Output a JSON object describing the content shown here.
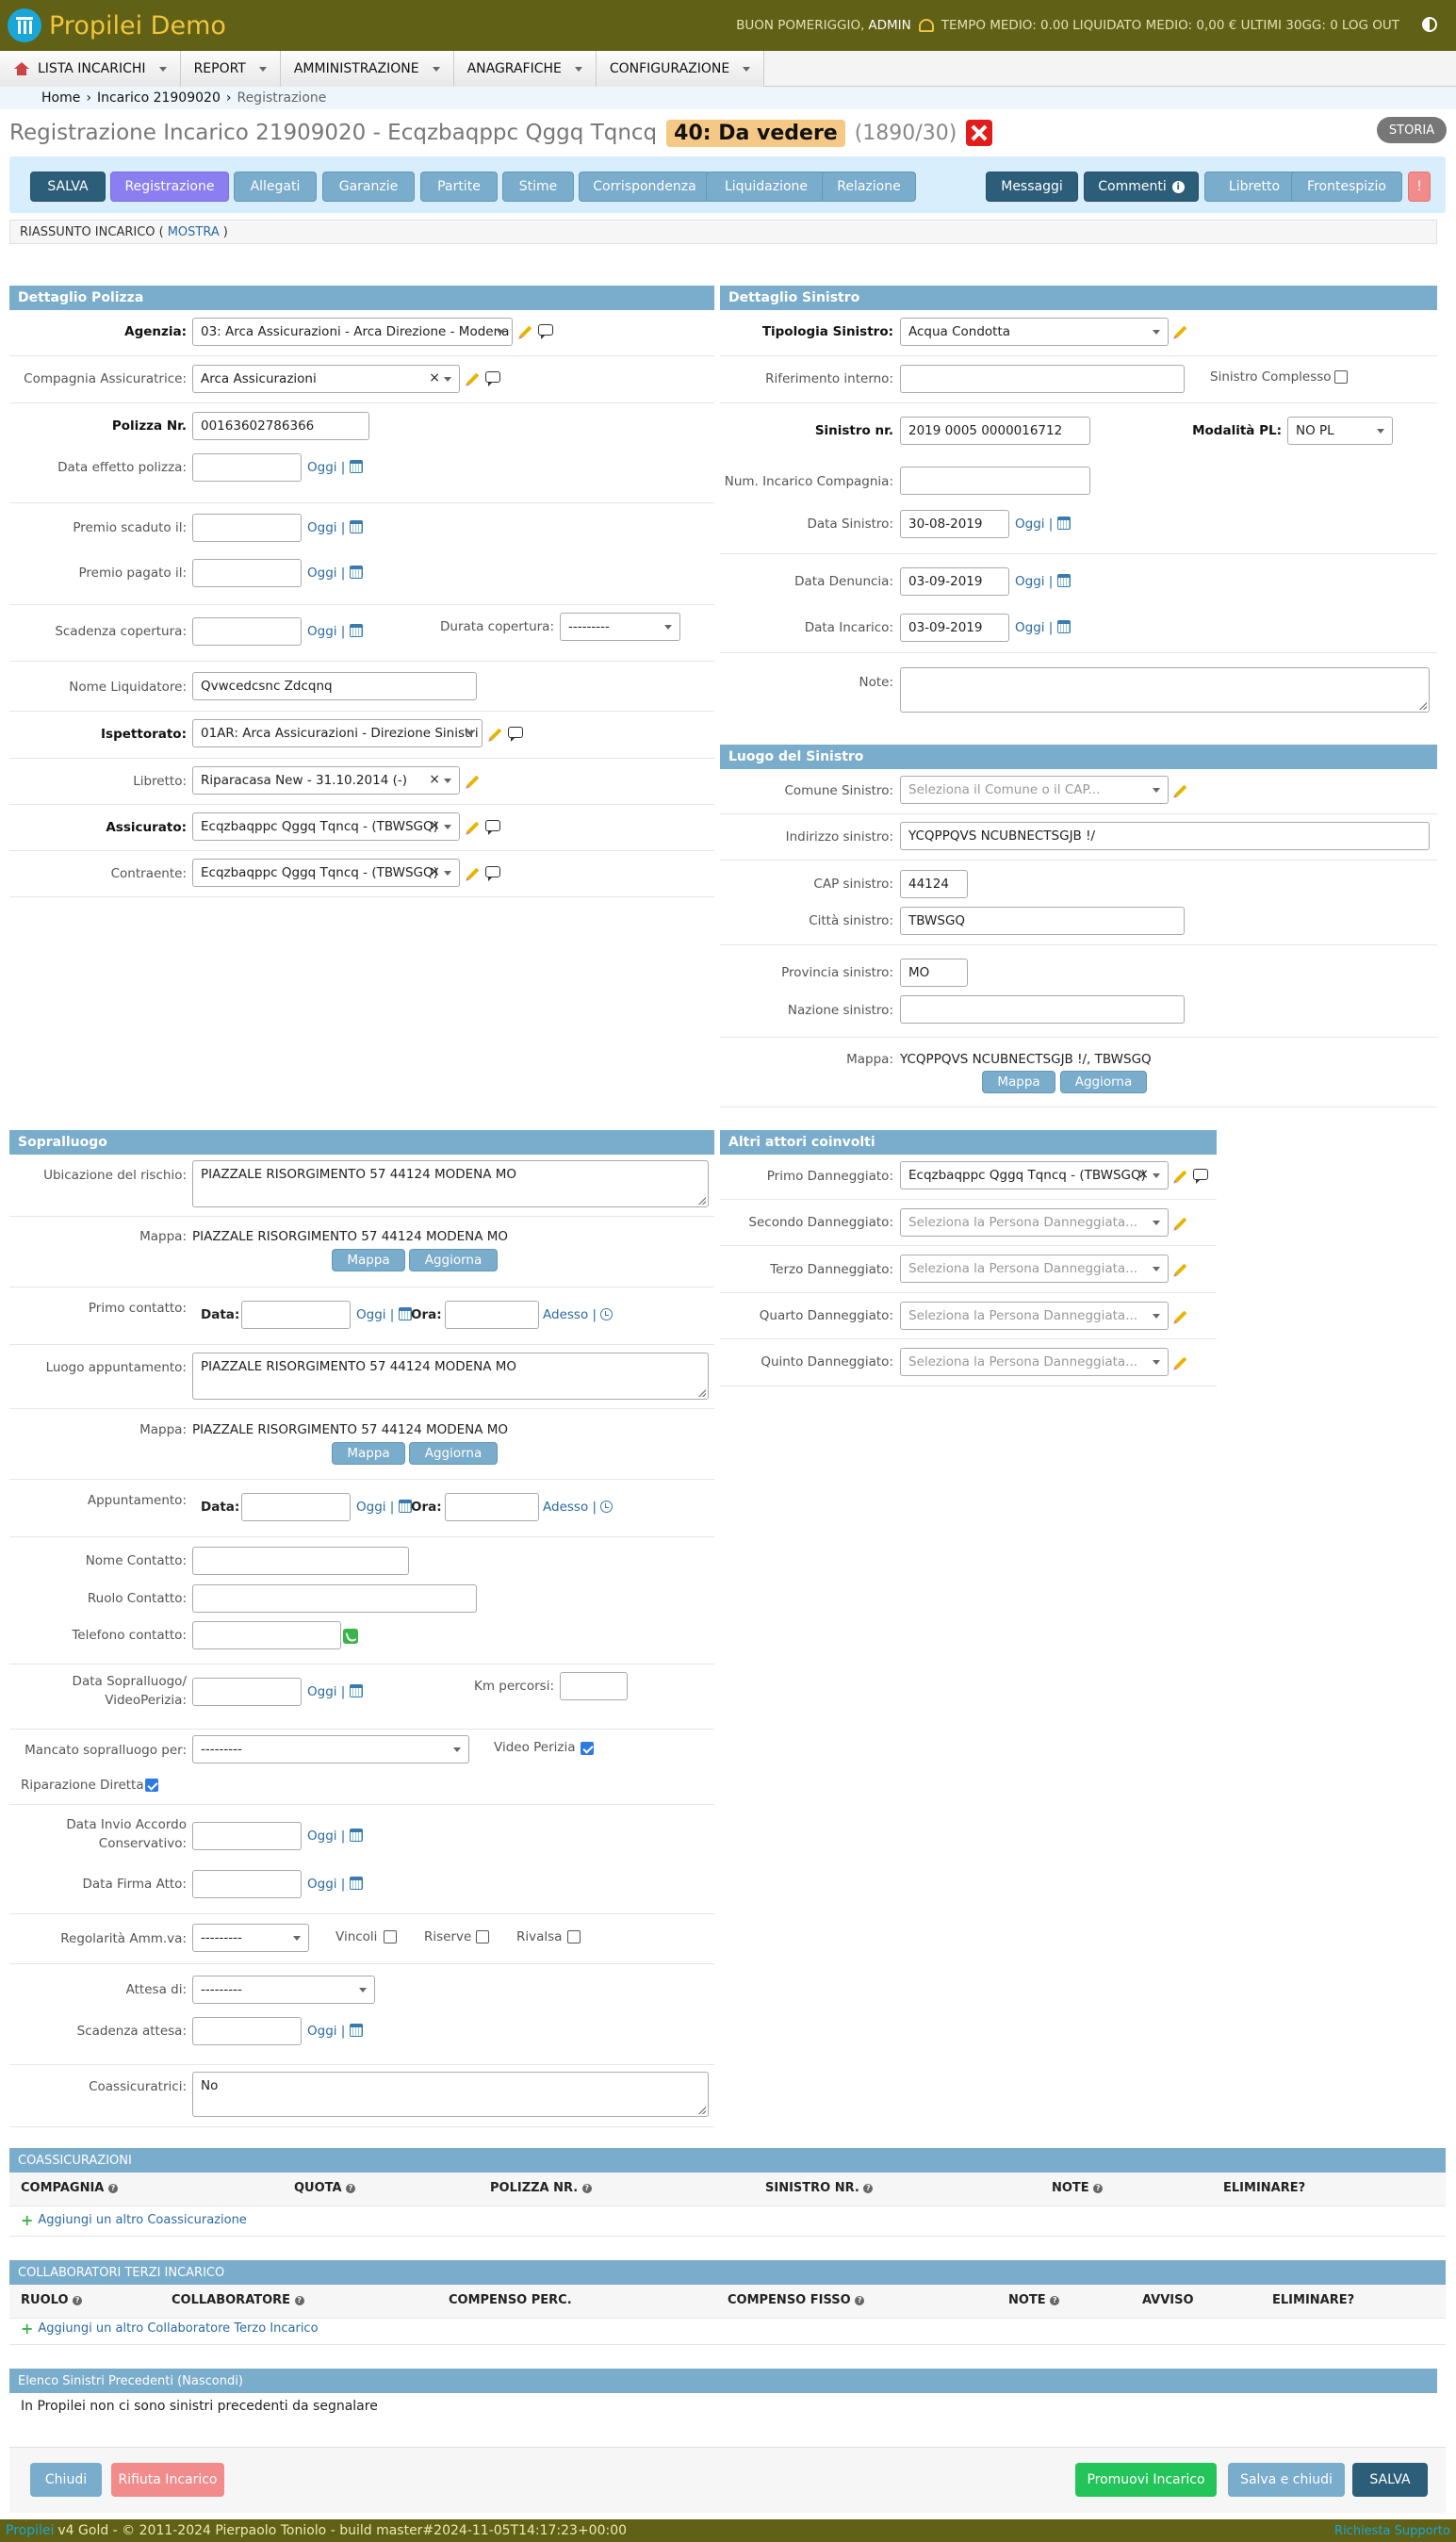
{
  "app": {
    "name": "Propilei Demo"
  },
  "topinfo": {
    "greeting": "BUON POMERIGGIO,",
    "user": "ADMIN",
    "tempo": "TEMPO MEDIO: 0.00",
    "liquidato": "LIQUIDATO MEDIO: 0,00 € ULTIMI 30GG: 0",
    "logout": "LOG OUT"
  },
  "menu": [
    "LISTA INCARICHI",
    "REPORT",
    "AMMINISTRAZIONE",
    "ANAGRAFICHE",
    "CONFIGURAZIONE"
  ],
  "breadcrumb": {
    "home": "Home",
    "sep": "›",
    "incarico": "Incarico 21909020",
    "current": "Registrazione"
  },
  "title": {
    "text": "Registrazione Incarico 21909020 - Ecqzbaqppc Qggq Tqncq",
    "status": "40: Da vedere",
    "count": "(1890/30)",
    "storia": "STORIA"
  },
  "toolbar": {
    "left": [
      "SALVA",
      "Registrazione",
      "Allegati",
      "Garanzie",
      "Partite",
      "Stime",
      "Corrispondenza",
      "Liquidazione",
      "Relazione"
    ],
    "right": [
      "Messaggi",
      "Commenti",
      "Libretto",
      "Frontespizio",
      "!"
    ]
  },
  "riassunto": {
    "label": "RIASSUNTO INCARICO (",
    "link": "MOSTRA",
    "close": ")"
  },
  "common": {
    "oggi": "Oggi |",
    "adesso": "Adesso |",
    "mappa": "Mappa",
    "aggiorna": "Aggiorna",
    "data": "Data:",
    "ora": "Ora:"
  },
  "polizza": {
    "head": "Dettaglio Polizza",
    "agenzia_lbl": "Agenzia:",
    "agenzia": "03: Arca Assicurazioni - Arca Direzione - Modena",
    "compagnia_lbl": "Compagnia Assicuratrice:",
    "compagnia": "Arca Assicurazioni",
    "polizza_lbl": "Polizza Nr.",
    "polizza": "00163602786366",
    "effetto_lbl": "Data effetto polizza:",
    "scaduto_lbl": "Premio scaduto il:",
    "pagato_lbl": "Premio pagato il:",
    "scadenza_lbl": "Scadenza copertura:",
    "durata_lbl": "Durata copertura:",
    "durata": "---------",
    "liquidatore_lbl": "Nome Liquidatore:",
    "liquidatore": "Qvwcedcsnc Zdcqnq",
    "ispettorato_lbl": "Ispettorato:",
    "ispettorato": "01AR: Arca Assicurazioni - Direzione Sinistri",
    "libretto_lbl": "Libretto:",
    "libretto": "Riparacasa New - 31.10.2014 (-)",
    "assicurato_lbl": "Assicurato:",
    "assicurato": "Ecqzbaqppc Qggq Tqncq - (TBWSGQ)",
    "contraente_lbl": "Contraente:",
    "contraente": "Ecqzbaqppc Qggq Tqncq - (TBWSGQ)"
  },
  "sinistro": {
    "head": "Dettaglio Sinistro",
    "tipologia_lbl": "Tipologia Sinistro:",
    "tipologia": "Acqua Condotta",
    "rif_lbl": "Riferimento interno:",
    "complesso_lbl": "Sinistro Complesso",
    "nr_lbl": "Sinistro nr.",
    "nr": "2019 0005 0000016712",
    "pl_lbl": "Modalità PL:",
    "pl": "NO PL",
    "num_lbl": "Num. Incarico Compagnia:",
    "data_lbl": "Data Sinistro:",
    "data": "30-08-2019",
    "denuncia_lbl": "Data Denuncia:",
    "denuncia": "03-09-2019",
    "incarico_lbl": "Data Incarico:",
    "incarico": "03-09-2019",
    "note_lbl": "Note:"
  },
  "luogo": {
    "head": "Luogo del Sinistro",
    "comune_lbl": "Comune Sinistro:",
    "comune_ph": "Seleziona il Comune o il CAP...",
    "indirizzo_lbl": "Indirizzo sinistro:",
    "indirizzo": "YCQPPQVS NCUBNECTSGJB !/",
    "cap_lbl": "CAP sinistro:",
    "cap": "44124",
    "citta_lbl": "Città sinistro:",
    "citta": "TBWSGQ",
    "provincia_lbl": "Provincia sinistro:",
    "provincia": "MO",
    "nazione_lbl": "Nazione sinistro:",
    "mappa_lbl": "Mappa:",
    "mappa": "YCQPPQVS NCUBNECTSGJB !/, TBWSGQ"
  },
  "sopralluogo": {
    "head": "Sopralluogo",
    "ubicazione_lbl": "Ubicazione del rischio:",
    "ubicazione": "PIAZZALE RISORGIMENTO 57 44124 MODENA MO",
    "mappa_lbl": "Mappa:",
    "mappa1": "PIAZZALE RISORGIMENTO 57 44124 MODENA MO",
    "primo_lbl": "Primo contatto:",
    "luogo_lbl": "Luogo appuntamento:",
    "luogo": "PIAZZALE RISORGIMENTO 57 44124 MODENA MO",
    "mappa2": "PIAZZALE RISORGIMENTO 57 44124 MODENA MO",
    "app_lbl": "Appuntamento:",
    "nome_lbl": "Nome Contatto:",
    "ruolo_lbl": "Ruolo Contatto:",
    "tel_lbl": "Telefono contatto:",
    "datasop_lbl1": "Data Sopralluogo/",
    "datasop_lbl2": "VideoPerizia:",
    "km_lbl": "Km percorsi:",
    "mancato_lbl": "Mancato sopralluogo per:",
    "mancato": "---------",
    "video_lbl": "Video Perizia",
    "riparazione_lbl": "Riparazione Diretta",
    "accordo_lbl1": "Data Invio Accordo",
    "accordo_lbl2": "Conservativo:",
    "firma_lbl": "Data Firma Atto:",
    "regolarita_lbl": "Regolarità Amm.va:",
    "regolarita": "---------",
    "vincoli_lbl": "Vincoli",
    "riserve_lbl": "Riserve",
    "rivalsa_lbl": "Rivalsa",
    "attesa_lbl": "Attesa di:",
    "attesa": "---------",
    "scadattesa_lbl": "Scadenza attesa:",
    "coass_lbl": "Coassicuratrici:",
    "coass": "No"
  },
  "attori": {
    "head": "Altri attori coinvolti",
    "primo_lbl": "Primo Danneggiato:",
    "primo": "Ecqzbaqppc Qggq Tqncq - (TBWSGQ)",
    "secondo_lbl": "Secondo Danneggiato:",
    "terzo_lbl": "Terzo Danneggiato:",
    "quarto_lbl": "Quarto Danneggiato:",
    "quinto_lbl": "Quinto Danneggiato:",
    "ph": "Seleziona la Persona Danneggiata..."
  },
  "coassicurazioni": {
    "head": "COASSICURAZIONI",
    "cols": [
      "COMPAGNIA",
      "QUOTA",
      "POLIZZA NR.",
      "SINISTRO NR.",
      "NOTE",
      "ELIMINARE?"
    ],
    "add": "Aggiungi un altro Coassicurazione"
  },
  "collaboratori": {
    "head": "COLLABORATORI TERZI INCARICO",
    "cols": [
      "RUOLO",
      "COLLABORATORE",
      "COMPENSO PERC.",
      "COMPENSO FISSO",
      "NOTE",
      "AVVISO",
      "ELIMINARE?"
    ],
    "add": "Aggiungi un altro Collaboratore Terzo Incarico"
  },
  "precedenti": {
    "head": "Elenco Sinistri Precedenti (Nascondi)",
    "text": "In Propilei non ci sono sinistri precedenti da segnalare"
  },
  "footer_buttons": {
    "chiudi": "Chiudi",
    "rifiuta": "Rifiuta Incarico",
    "promuovi": "Promuovi Incarico",
    "salvachiudi": "Salva e chiudi",
    "salva": "SALVA"
  },
  "footer": {
    "brand": "Propilei",
    "text": "v4 Gold - © 2011-2024 Pierpaolo Toniolo - build master#2024-11-05T14:17:23+00:00",
    "right": "Richiesta Supporto"
  }
}
